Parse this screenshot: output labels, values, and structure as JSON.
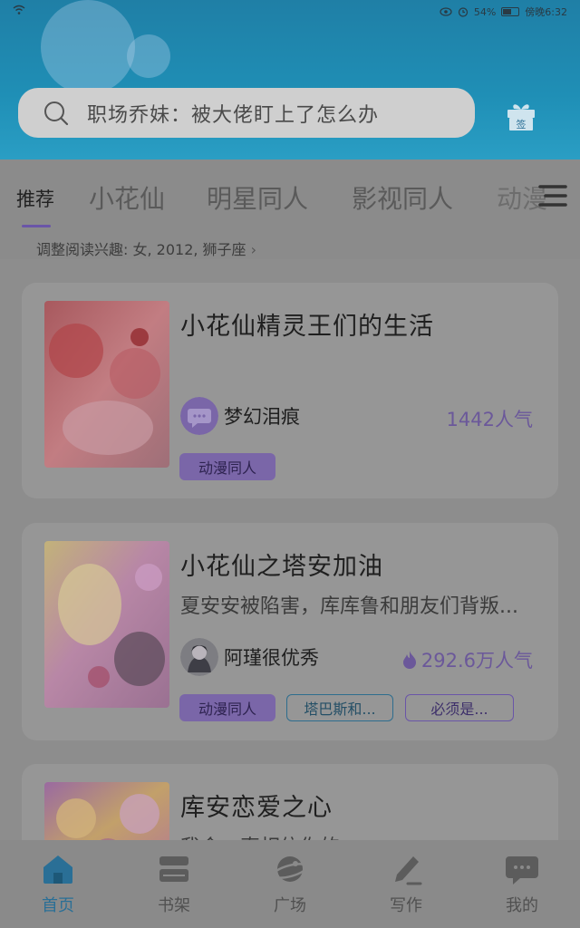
{
  "status_bar": {
    "battery": "54%",
    "time": "傍晚6:32"
  },
  "search": {
    "placeholder": "职场乔妹：被大佬盯上了怎么办"
  },
  "gift": {
    "label": "签",
    "icon": "gift-icon"
  },
  "tabs": [
    {
      "label": "推荐",
      "active": true
    },
    {
      "label": "小花仙"
    },
    {
      "label": "明星同人"
    },
    {
      "label": "影视同人"
    },
    {
      "label": "动漫"
    }
  ],
  "interest": {
    "text": "调整阅读兴趣: 女, 2012, 狮子座"
  },
  "books": [
    {
      "title": "小花仙精灵王们的生活",
      "desc": "",
      "author": "梦幻泪痕",
      "popularity": "1442人气",
      "tags": [
        "动漫同人"
      ]
    },
    {
      "title": "小花仙之塔安加油",
      "desc": "夏安安被陷害，库库鲁和朋友们背叛...",
      "author": "阿瑾很优秀",
      "popularity": "292.6万人气",
      "tags": [
        "动漫同人",
        "塔巴斯和...",
        "必须是..."
      ]
    },
    {
      "title": "库安恋爱之心",
      "desc": "我会一直相信你的",
      "author": "",
      "popularity": "",
      "tags": []
    }
  ],
  "nav": [
    {
      "label": "首页",
      "icon": "home-icon",
      "active": true
    },
    {
      "label": "书架",
      "icon": "bookshelf-icon"
    },
    {
      "label": "广场",
      "icon": "planet-icon"
    },
    {
      "label": "写作",
      "icon": "pen-icon"
    },
    {
      "label": "我的",
      "icon": "chat-bubble-icon"
    }
  ],
  "colors": {
    "header": "#1f8fb6",
    "accent_purple": "#6a55a8",
    "accent_blue": "#2a6f96"
  }
}
